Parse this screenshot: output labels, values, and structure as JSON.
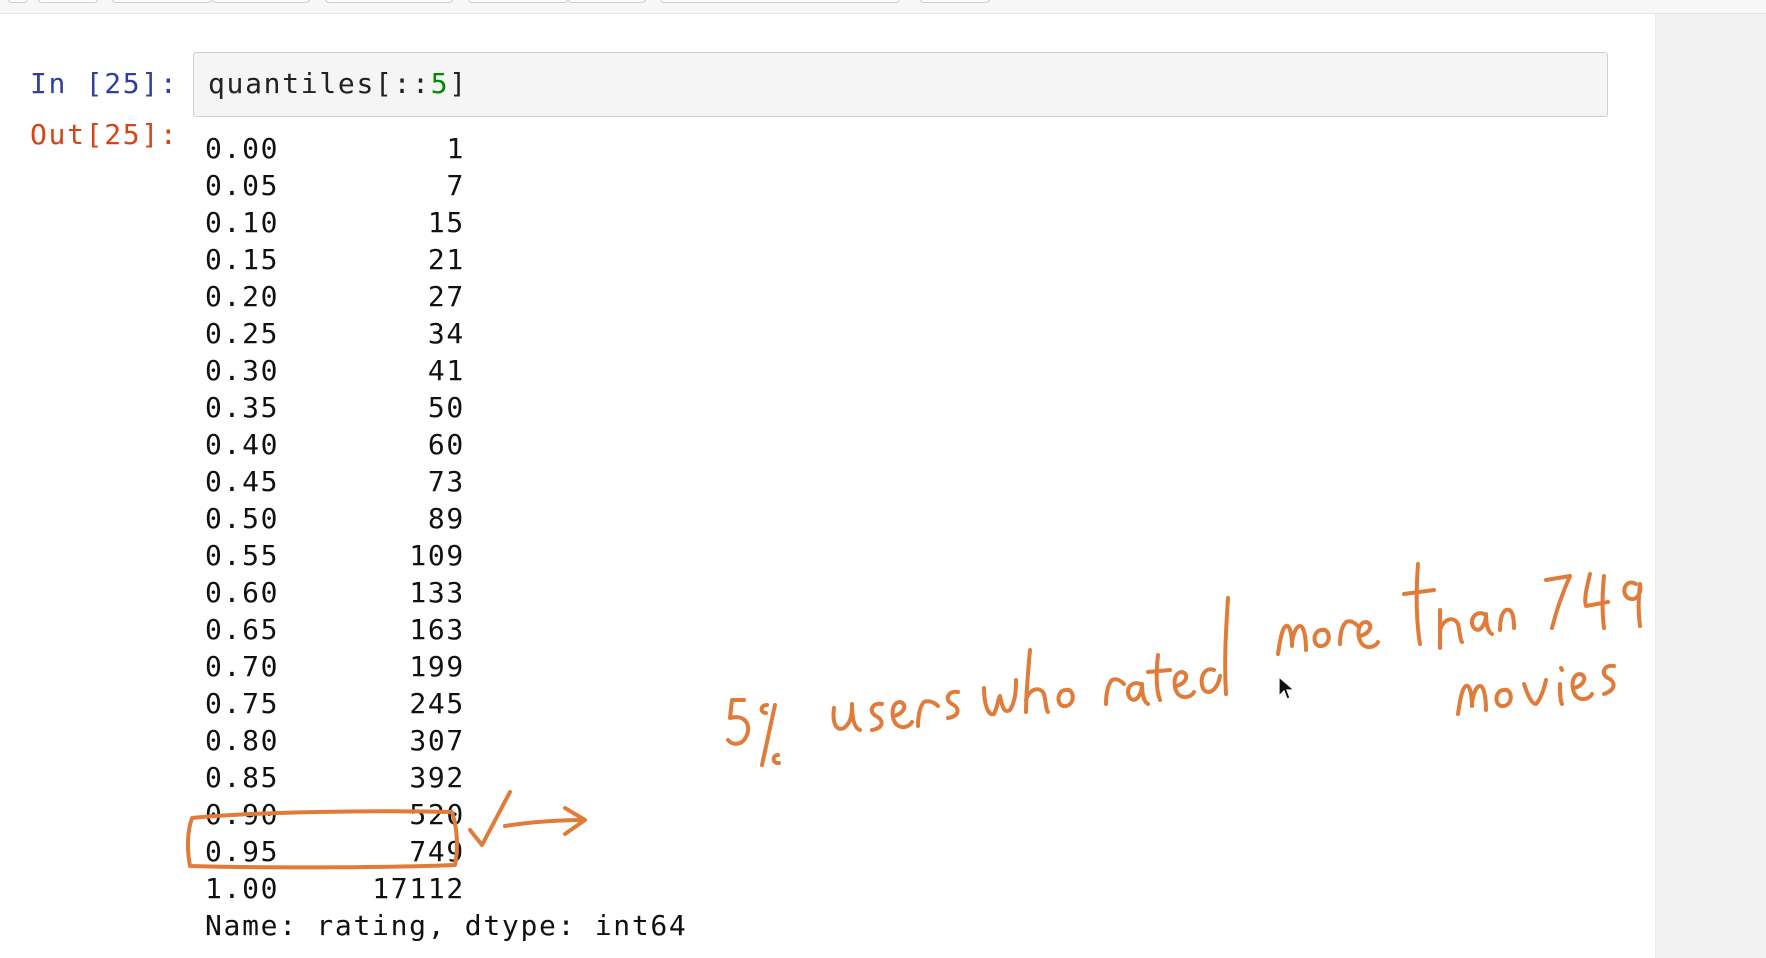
{
  "input_cell": {
    "prompt": "In [25]:",
    "code_prefix": "quantiles[::",
    "code_number": "5",
    "code_suffix": "]"
  },
  "output_cell": {
    "prompt": "Out[25]:",
    "rows": [
      {
        "quantile": "0.00",
        "value": "1"
      },
      {
        "quantile": "0.05",
        "value": "7"
      },
      {
        "quantile": "0.10",
        "value": "15"
      },
      {
        "quantile": "0.15",
        "value": "21"
      },
      {
        "quantile": "0.20",
        "value": "27"
      },
      {
        "quantile": "0.25",
        "value": "34"
      },
      {
        "quantile": "0.30",
        "value": "41"
      },
      {
        "quantile": "0.35",
        "value": "50"
      },
      {
        "quantile": "0.40",
        "value": "60"
      },
      {
        "quantile": "0.45",
        "value": "73"
      },
      {
        "quantile": "0.50",
        "value": "89"
      },
      {
        "quantile": "0.55",
        "value": "109"
      },
      {
        "quantile": "0.60",
        "value": "133"
      },
      {
        "quantile": "0.65",
        "value": "163"
      },
      {
        "quantile": "0.70",
        "value": "199"
      },
      {
        "quantile": "0.75",
        "value": "245"
      },
      {
        "quantile": "0.80",
        "value": "307"
      },
      {
        "quantile": "0.85",
        "value": "392"
      },
      {
        "quantile": "0.90",
        "value": "520"
      },
      {
        "quantile": "0.95",
        "value": "749"
      },
      {
        "quantile": "1.00",
        "value": "17112"
      }
    ],
    "footer": "Name: rating, dtype: int64"
  },
  "annotation": {
    "handwritten_line1": "5% users who rated more than 749",
    "handwritten_line2": "movies",
    "highlighted_quantile": "0.95",
    "ink_color": "#e07b39"
  },
  "colors": {
    "in_prompt": "#303f9f",
    "out_prompt": "#d84315",
    "code_number": "#008800"
  }
}
